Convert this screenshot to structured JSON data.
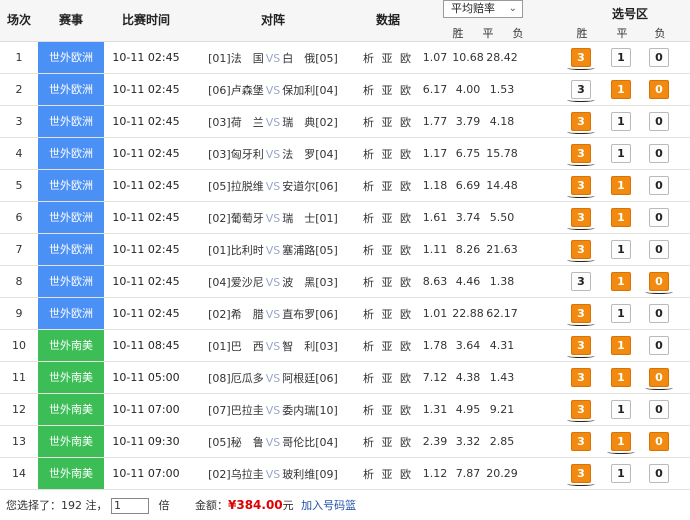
{
  "header": {
    "col_no": "场次",
    "col_league": "赛事",
    "col_time": "比赛时间",
    "col_match": "对阵",
    "col_data": "数据",
    "odds_select": "平均赔率",
    "odds_win": "胜",
    "odds_draw": "平",
    "odds_lose": "负",
    "sel_title": "选号区",
    "sel_win": "胜",
    "sel_draw": "平",
    "sel_lose": "负"
  },
  "colors": {
    "europe": "#4a90f5",
    "america": "#3cbd55",
    "selected": "#f28a0f"
  },
  "data_link": "析 亚 欧",
  "vs": "VS",
  "rows": [
    {
      "no": "1",
      "league": "世外欧洲",
      "region": "europe",
      "time": "10-11 02:45",
      "home": "[01]法　国",
      "away": "白　俄[05]",
      "w": "1.07",
      "d": "10.68",
      "l": "28.42",
      "p3": true,
      "p1": false,
      "p0": false,
      "mark": "3"
    },
    {
      "no": "2",
      "league": "世外欧洲",
      "region": "europe",
      "time": "10-11 02:45",
      "home": "[06]卢森堡",
      "away": "保加利[04]",
      "w": "6.17",
      "d": "4.00",
      "l": "1.53",
      "p3": false,
      "p1": true,
      "p0": true,
      "mark": "3"
    },
    {
      "no": "3",
      "league": "世外欧洲",
      "region": "europe",
      "time": "10-11 02:45",
      "home": "[03]荷　兰",
      "away": "瑞　典[02]",
      "w": "1.77",
      "d": "3.79",
      "l": "4.18",
      "p3": true,
      "p1": false,
      "p0": false,
      "mark": "3"
    },
    {
      "no": "4",
      "league": "世外欧洲",
      "region": "europe",
      "time": "10-11 02:45",
      "home": "[03]匈牙利",
      "away": "法　罗[04]",
      "w": "1.17",
      "d": "6.75",
      "l": "15.78",
      "p3": true,
      "p1": false,
      "p0": false,
      "mark": "3"
    },
    {
      "no": "5",
      "league": "世外欧洲",
      "region": "europe",
      "time": "10-11 02:45",
      "home": "[05]拉脱维",
      "away": "安道尔[06]",
      "w": "1.18",
      "d": "6.69",
      "l": "14.48",
      "p3": true,
      "p1": true,
      "p0": false,
      "mark": "3"
    },
    {
      "no": "6",
      "league": "世外欧洲",
      "region": "europe",
      "time": "10-11 02:45",
      "home": "[02]葡萄牙",
      "away": "瑞　士[01]",
      "w": "1.61",
      "d": "3.74",
      "l": "5.50",
      "p3": true,
      "p1": true,
      "p0": false,
      "mark": "3"
    },
    {
      "no": "7",
      "league": "世外欧洲",
      "region": "europe",
      "time": "10-11 02:45",
      "home": "[01]比利时",
      "away": "塞浦路[05]",
      "w": "1.11",
      "d": "8.26",
      "l": "21.63",
      "p3": true,
      "p1": false,
      "p0": false,
      "mark": "3"
    },
    {
      "no": "8",
      "league": "世外欧洲",
      "region": "europe",
      "time": "10-11 02:45",
      "home": "[04]爱沙尼",
      "away": "波　黑[03]",
      "w": "8.63",
      "d": "4.46",
      "l": "1.38",
      "p3": false,
      "p1": true,
      "p0": true,
      "mark": "0"
    },
    {
      "no": "9",
      "league": "世外欧洲",
      "region": "europe",
      "time": "10-11 02:45",
      "home": "[02]希　腊",
      "away": "直布罗[06]",
      "w": "1.01",
      "d": "22.88",
      "l": "62.17",
      "p3": true,
      "p1": false,
      "p0": false,
      "mark": "3"
    },
    {
      "no": "10",
      "league": "世外南美",
      "region": "america",
      "time": "10-11 08:45",
      "home": "[01]巴　西",
      "away": "智　利[03]",
      "w": "1.78",
      "d": "3.64",
      "l": "4.31",
      "p3": true,
      "p1": true,
      "p0": false,
      "mark": "3"
    },
    {
      "no": "11",
      "league": "世外南美",
      "region": "america",
      "time": "10-11 05:00",
      "home": "[08]厄瓜多",
      "away": "阿根廷[06]",
      "w": "7.12",
      "d": "4.38",
      "l": "1.43",
      "p3": true,
      "p1": true,
      "p0": true,
      "mark": "0"
    },
    {
      "no": "12",
      "league": "世外南美",
      "region": "america",
      "time": "10-11 07:00",
      "home": "[07]巴拉圭",
      "away": "委内瑞[10]",
      "w": "1.31",
      "d": "4.95",
      "l": "9.21",
      "p3": true,
      "p1": false,
      "p0": false,
      "mark": "3"
    },
    {
      "no": "13",
      "league": "世外南美",
      "region": "america",
      "time": "10-11 09:30",
      "home": "[05]秘　鲁",
      "away": "哥伦比[04]",
      "w": "2.39",
      "d": "3.32",
      "l": "2.85",
      "p3": true,
      "p1": true,
      "p0": true,
      "mark": "1"
    },
    {
      "no": "14",
      "league": "世外南美",
      "region": "america",
      "time": "10-11 07:00",
      "home": "[02]乌拉圭",
      "away": "玻利维[09]",
      "w": "1.12",
      "d": "7.87",
      "l": "20.29",
      "p3": true,
      "p1": false,
      "p0": false,
      "mark": "3"
    }
  ],
  "footer": {
    "prefix": "您选择了：",
    "count": "192",
    "unit": "注，",
    "multiplier": "1",
    "mult_unit": "倍",
    "amount_label": "金额：",
    "amount": "¥384.00",
    "amount_unit": "元",
    "cart_link": "加入号码篮"
  }
}
